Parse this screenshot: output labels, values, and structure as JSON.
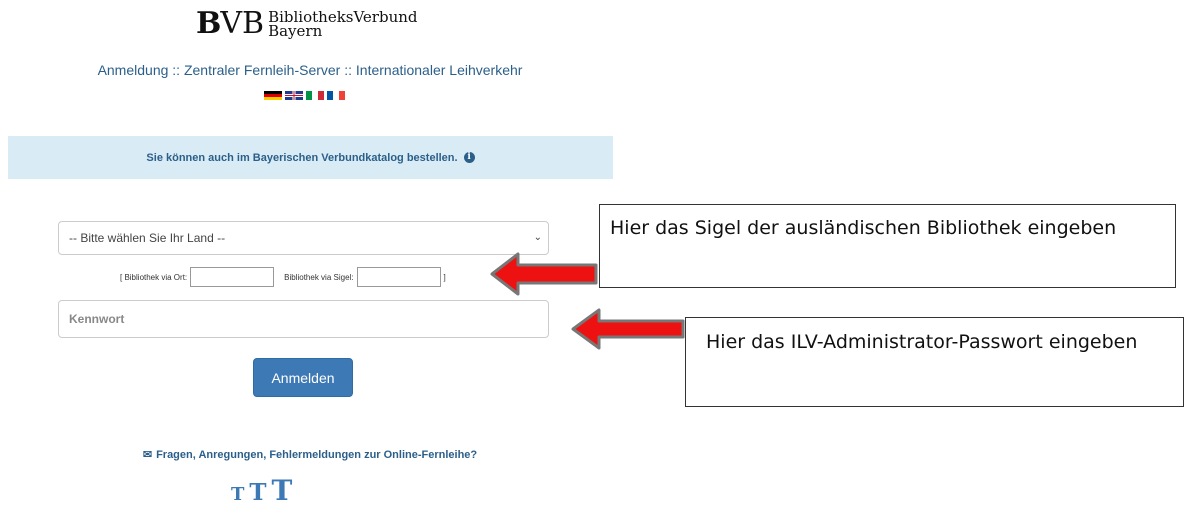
{
  "logo": {
    "mark_b": "B",
    "mark_vb": "VB",
    "line1": "BibliotheksVerbund",
    "line2": "Bayern"
  },
  "header": {
    "subtitle": "Anmeldung :: Zentraler Fernleih-Server :: Internationaler Leihverkehr"
  },
  "languages": [
    "de-flag",
    "gb-flag",
    "it-flag",
    "fr-flag"
  ],
  "info": {
    "text": "Sie können auch im Bayerischen Verbundkatalog bestellen.",
    "icon": "info-icon"
  },
  "form": {
    "country_select": "-- Bitte wählen Sie Ihr Land --",
    "via_open": "[ Bibliothek via Ort:",
    "via_sigel": "Bibliothek via Sigel:",
    "via_close": "]",
    "password_placeholder": "Kennwort",
    "login_label": "Anmelden"
  },
  "footer": {
    "feedback": "Fragen, Anregungen, Fehlermeldungen zur Online-Fernleihe?",
    "size_small": "T",
    "size_medium": "T",
    "size_large": "T"
  },
  "annotations": {
    "note1": "Hier das Sigel der ausländischen Bibliothek eingeben",
    "note2": "Hier das ILV-Administrator-Passwort eingeben"
  },
  "colors": {
    "link": "#2b5f8a",
    "button": "#3d7ab5",
    "info_bg": "#d9ecf5",
    "arrow": "#ee1111"
  }
}
